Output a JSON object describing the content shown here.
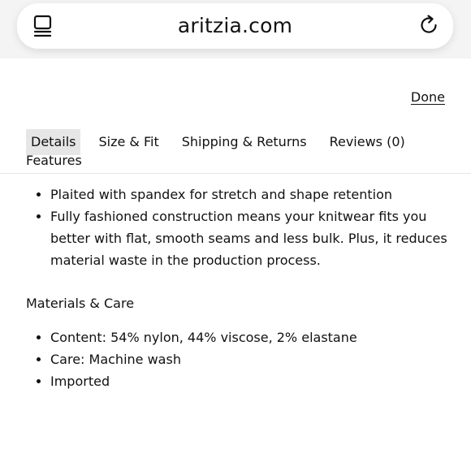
{
  "browser": {
    "url": "aritzia.com",
    "tabs_icon": "tabs-icon",
    "reload_icon": "reload-icon"
  },
  "sheet": {
    "done_label": "Done",
    "tabs": [
      {
        "label": "Details",
        "active": true
      },
      {
        "label": "Size & Fit",
        "active": false
      },
      {
        "label": "Shipping & Returns",
        "active": false
      },
      {
        "label": "Reviews (0)",
        "active": false
      }
    ],
    "sections": [
      {
        "title": "Features",
        "items": [
          "Plaited with spandex for stretch and shape retention",
          "Fully fashioned construction means your knitwear fits you better with flat, smooth seams and less bulk. Plus, it reduces material waste in the production process."
        ]
      },
      {
        "title": "Materials & Care",
        "items": [
          "Content: 54% nylon, 44% viscose, 2% elastane",
          "Care: Machine wash",
          "Imported"
        ]
      }
    ]
  },
  "colors": {
    "background": "#ffffff",
    "top_area": "#f4f4f4",
    "active_tab": "#e6e6e6",
    "text": "#111111"
  }
}
